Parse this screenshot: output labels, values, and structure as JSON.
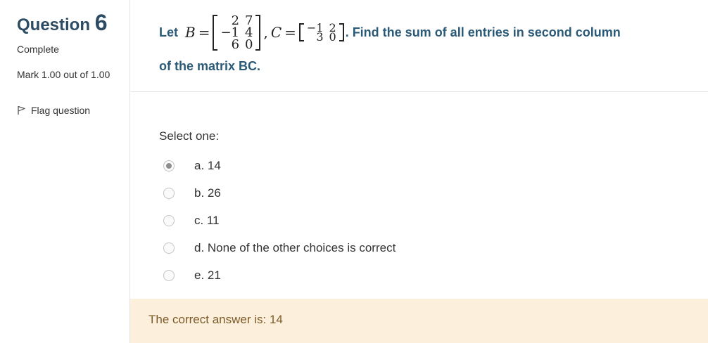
{
  "info": {
    "question_word": "Question",
    "question_number": "6",
    "state": "Complete",
    "grade": "Mark 1.00 out of 1.00",
    "flag_label": "Flag question"
  },
  "question": {
    "prefix": "Let",
    "var_b": "B",
    "equals": "=",
    "matrix_b": [
      "2",
      "7",
      "−1",
      "4",
      "6",
      "0"
    ],
    "separator": ",",
    "var_c": "C",
    "matrix_c": [
      "−1",
      "2",
      "3",
      "0"
    ],
    "suffix_line1": ". Find the sum of all entries in second column",
    "suffix_line2": "of the matrix BC."
  },
  "answer": {
    "prompt": "Select one:",
    "options": [
      {
        "label": "a. 14",
        "checked": true
      },
      {
        "label": "b. 26",
        "checked": false
      },
      {
        "label": "c. 11",
        "checked": false
      },
      {
        "label": "d. None of the other choices is correct",
        "checked": false
      },
      {
        "label": "e. 21",
        "checked": false
      }
    ]
  },
  "feedback": {
    "text": "The correct answer is: 14"
  },
  "colors": {
    "heading": "#2d4c63",
    "question_text": "#2b5a78",
    "feedback_bg": "#fcefdc",
    "feedback_text": "#7d5a29"
  }
}
